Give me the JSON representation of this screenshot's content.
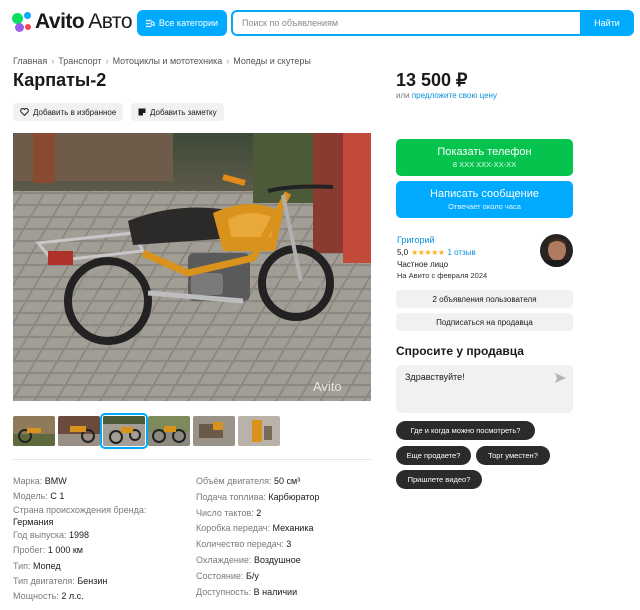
{
  "header": {
    "logo_brand": "Avito",
    "logo_suffix": "Авто",
    "categories_label": "Все категории",
    "search_placeholder": "Поиск по объявлениям",
    "find_label": "Найти"
  },
  "breadcrumb": [
    "Главная",
    "Транспорт",
    "Мотоциклы и мототехника",
    "Мопеды и скутеры"
  ],
  "listing": {
    "title": "Карпаты-2",
    "favorite_label": "Добавить в избранное",
    "note_label": "Добавить заметку",
    "photo_watermark": "Avito",
    "thumbnail_count": 6,
    "active_thumbnail": 3
  },
  "specs_left": [
    {
      "key": "Марка:",
      "value": "BMW"
    },
    {
      "key": "Модель:",
      "value": "C 1"
    },
    {
      "key": "Страна происхождения бренда:",
      "value": ""
    },
    {
      "key": "",
      "value": "Германия"
    },
    {
      "key": "Год выпуска:",
      "value": "1998"
    },
    {
      "key": "Пробег:",
      "value": "1 000 км"
    },
    {
      "key": "Тип:",
      "value": "Мопед"
    },
    {
      "key": "Тип двигателя:",
      "value": "Бензин"
    },
    {
      "key": "Мощность:",
      "value": "2 л.с."
    }
  ],
  "specs_right": [
    {
      "key": "Объём двигателя:",
      "value": "50 см³"
    },
    {
      "key": "Подача топлива:",
      "value": "Карбюратор"
    },
    {
      "key": "Число тактов:",
      "value": "2"
    },
    {
      "key": "Коробка передач:",
      "value": "Механика"
    },
    {
      "key": "Количество передач:",
      "value": "3"
    },
    {
      "key": "Охлаждение:",
      "value": "Воздушное"
    },
    {
      "key": "Состояние:",
      "value": "Б/у"
    },
    {
      "key": "Доступность:",
      "value": "В наличии"
    }
  ],
  "price": {
    "value": "13 500 ₽",
    "or": "или",
    "offer_link": "предложите свою цену"
  },
  "contact": {
    "phone_label": "Показать телефон",
    "phone_masked": "8 XXX XXX-XX-XX",
    "message_label": "Написать сообщение",
    "message_sub": "Отвечает около часа"
  },
  "seller": {
    "name": "Григорий",
    "rating": "5,0",
    "stars": "★★★★★",
    "reviews": "1 отзыв",
    "type": "Частное лицо",
    "since": "На Авито с февраля 2024",
    "listings_label": "2 объявления пользователя",
    "subscribe_label": "Подписаться на продавца"
  },
  "ask": {
    "title": "Спросите у продавца",
    "message_value": "Здравствуйте!",
    "chips": [
      "Где и когда можно посмотреть?",
      "Еще продаете?",
      "Торг уместен?",
      "Пришлете видео?"
    ]
  },
  "colors": {
    "accent_blue": "#00aaff",
    "phone_green": "#04c44d",
    "link_blue": "#0a8fd8",
    "star_yellow": "#ffb021"
  }
}
